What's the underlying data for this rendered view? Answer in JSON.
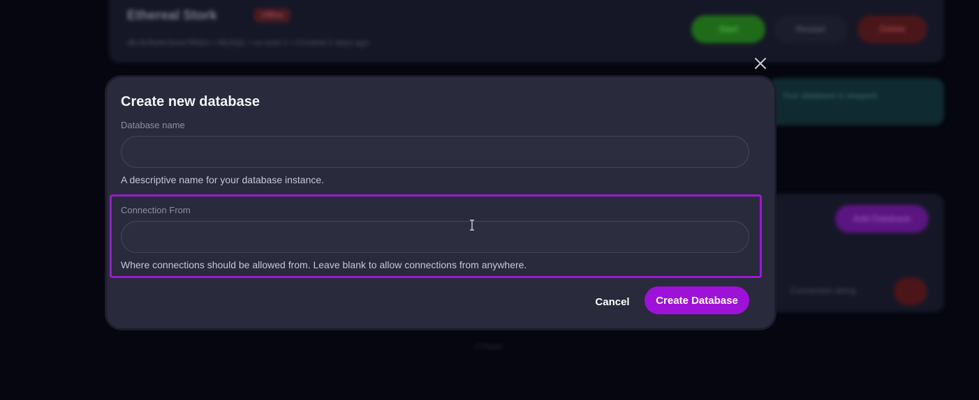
{
  "background": {
    "title": "Ethereal Stork",
    "badge": "Offline",
    "meta": "db-0c9a4e3a1b7f4d2c  •  MySQL  •  us-east-1  •  Created 2 days ago",
    "start_label": "Start",
    "restart_label": "Restart",
    "delete_label": "Delete",
    "alert_text": "Your database is stopped.",
    "add_label": "Add Database",
    "row_text": "Connection string",
    "footer_text": "© Panel"
  },
  "modal": {
    "title": "Create new database",
    "database_name": {
      "label": "Database name",
      "value": "",
      "placeholder": "",
      "helper": "A descriptive name for your database instance."
    },
    "connection_from": {
      "label": "Connection From",
      "value": "",
      "placeholder": "",
      "helper": "Where connections should be allowed from. Leave blank to allow connections from anywhere."
    },
    "cancel_label": "Cancel",
    "submit_label": "Create Database"
  },
  "colors": {
    "accent": "#9d12d6",
    "modal_bg": "#292a3c",
    "page_bg": "#05060f"
  },
  "icons": {
    "close": "close-icon",
    "cursor": "text-cursor-icon"
  }
}
